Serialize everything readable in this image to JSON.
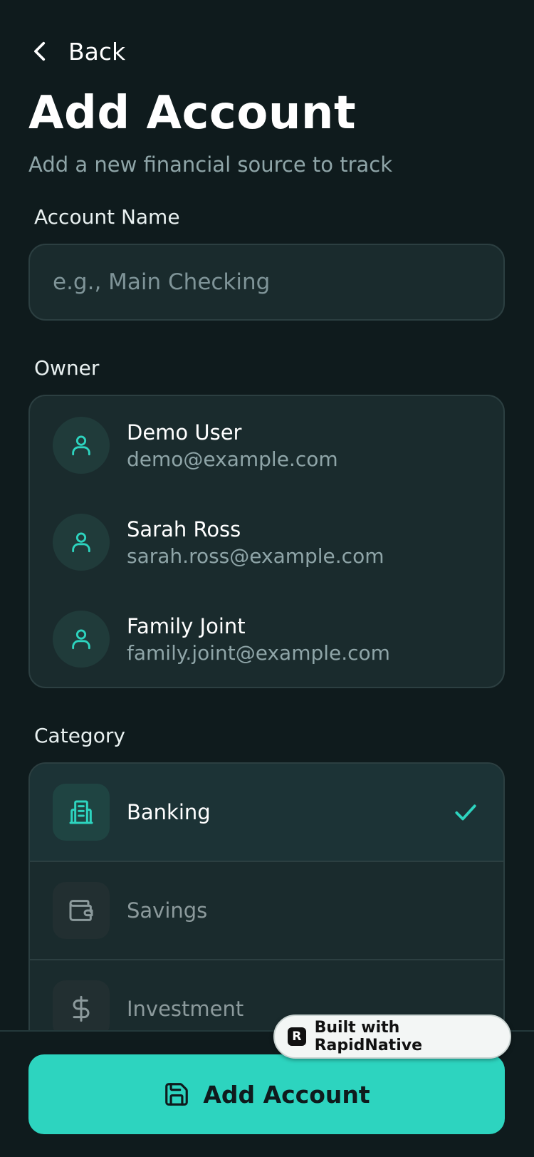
{
  "header": {
    "back_label": "Back",
    "title": "Add Account",
    "subtitle": "Add a new financial source to track"
  },
  "account_name": {
    "label": "Account Name",
    "value": "",
    "placeholder": "e.g., Main Checking"
  },
  "owner": {
    "label": "Owner",
    "items": [
      {
        "name": "Demo User",
        "email": "demo@example.com"
      },
      {
        "name": "Sarah Ross",
        "email": "sarah.ross@example.com"
      },
      {
        "name": "Family Joint",
        "email": "family.joint@example.com"
      }
    ]
  },
  "category": {
    "label": "Category",
    "selected": "Banking",
    "items": [
      {
        "label": "Banking",
        "icon": "building-icon"
      },
      {
        "label": "Savings",
        "icon": "wallet-icon"
      },
      {
        "label": "Investment",
        "icon": "dollar-icon"
      }
    ]
  },
  "submit": {
    "label": "Add Account",
    "icon": "save-icon"
  },
  "badge": {
    "text": "Built with RapidNative",
    "logo_letter": "R"
  },
  "colors": {
    "background": "#0f1b1d",
    "card": "#1a2b2d",
    "accent": "#2dd4bf",
    "muted_text": "#8fa5a8"
  }
}
